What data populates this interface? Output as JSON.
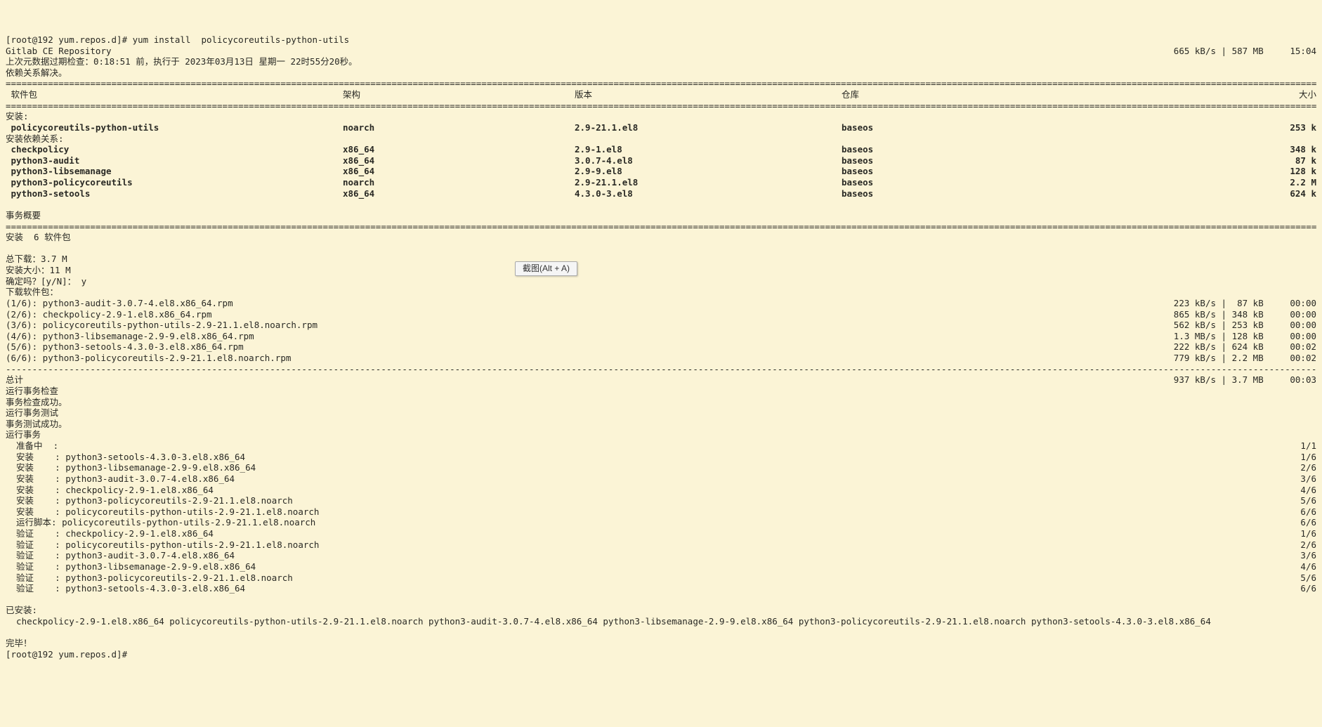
{
  "header": {
    "prompt_left": "[root@192 yum.repos.d]# yum install  policycoreutils-python-utils",
    "repo_line_left": "Gitlab CE Repository",
    "repo_line_right": "665 kB/s | 587 MB     15:04",
    "last_check": "上次元数据过期检查：0:18:51 前，执行于 2023年03月13日 星期一 22时55分20秒。",
    "dep_resolved": "依赖关系解决。"
  },
  "table_header": {
    "pkg": " 软件包",
    "arch": "架构",
    "ver": "版本",
    "repo": "仓库",
    "size": "大小"
  },
  "install_label": "安装:",
  "dep_install_label": "安装依赖关系:",
  "main_pkg": {
    "name": " policycoreutils-python-utils",
    "arch": "noarch",
    "ver": "2.9-21.1.el8",
    "repo": "baseos",
    "size": "253 k"
  },
  "deps": [
    {
      "name": " checkpolicy",
      "arch": "x86_64",
      "ver": "2.9-1.el8",
      "repo": "baseos",
      "size": "348 k"
    },
    {
      "name": " python3-audit",
      "arch": "x86_64",
      "ver": "3.0.7-4.el8",
      "repo": "baseos",
      "size": "87 k"
    },
    {
      "name": " python3-libsemanage",
      "arch": "x86_64",
      "ver": "2.9-9.el8",
      "repo": "baseos",
      "size": "128 k"
    },
    {
      "name": " python3-policycoreutils",
      "arch": "noarch",
      "ver": "2.9-21.1.el8",
      "repo": "baseos",
      "size": "2.2 M"
    },
    {
      "name": " python3-setools",
      "arch": "x86_64",
      "ver": "4.3.0-3.el8",
      "repo": "baseos",
      "size": "624 k"
    }
  ],
  "summary_label": "事务概要",
  "install_count": "安装  6 软件包",
  "totals": {
    "download": "总下载：3.7 M",
    "install_size": "安装大小：11 M",
    "confirm": "确定吗？[y/N]： y",
    "downloading": "下载软件包："
  },
  "downloads": [
    {
      "line": "(1/6): python3-audit-3.0.7-4.el8.x86_64.rpm",
      "stats": "223 kB/s |  87 kB     00:00"
    },
    {
      "line": "(2/6): checkpolicy-2.9-1.el8.x86_64.rpm",
      "stats": "865 kB/s | 348 kB     00:00"
    },
    {
      "line": "(3/6): policycoreutils-python-utils-2.9-21.1.el8.noarch.rpm",
      "stats": "562 kB/s | 253 kB     00:00"
    },
    {
      "line": "(4/6): python3-libsemanage-2.9-9.el8.x86_64.rpm",
      "stats": "1.3 MB/s | 128 kB     00:00"
    },
    {
      "line": "(5/6): python3-setools-4.3.0-3.el8.x86_64.rpm",
      "stats": "222 kB/s | 624 kB     00:02"
    },
    {
      "line": "(6/6): python3-policycoreutils-2.9-21.1.el8.noarch.rpm",
      "stats": "779 kB/s | 2.2 MB     00:02"
    }
  ],
  "total_line": {
    "left": "总计",
    "right": "937 kB/s | 3.7 MB     00:03"
  },
  "trans_lines": [
    "运行事务检查",
    "事务检查成功。",
    "运行事务测试",
    "事务测试成功。",
    "运行事务"
  ],
  "steps": [
    {
      "left": "  准备中  :",
      "right": "1/1"
    },
    {
      "left": "  安装    : python3-setools-4.3.0-3.el8.x86_64",
      "right": "1/6"
    },
    {
      "left": "  安装    : python3-libsemanage-2.9-9.el8.x86_64",
      "right": "2/6"
    },
    {
      "left": "  安装    : python3-audit-3.0.7-4.el8.x86_64",
      "right": "3/6"
    },
    {
      "left": "  安装    : checkpolicy-2.9-1.el8.x86_64",
      "right": "4/6"
    },
    {
      "left": "  安装    : python3-policycoreutils-2.9-21.1.el8.noarch",
      "right": "5/6"
    },
    {
      "left": "  安装    : policycoreutils-python-utils-2.9-21.1.el8.noarch",
      "right": "6/6"
    },
    {
      "left": "  运行脚本: policycoreutils-python-utils-2.9-21.1.el8.noarch",
      "right": "6/6"
    },
    {
      "left": "  验证    : checkpolicy-2.9-1.el8.x86_64",
      "right": "1/6"
    },
    {
      "left": "  验证    : policycoreutils-python-utils-2.9-21.1.el8.noarch",
      "right": "2/6"
    },
    {
      "left": "  验证    : python3-audit-3.0.7-4.el8.x86_64",
      "right": "3/6"
    },
    {
      "left": "  验证    : python3-libsemanage-2.9-9.el8.x86_64",
      "right": "4/6"
    },
    {
      "left": "  验证    : python3-policycoreutils-2.9-21.1.el8.noarch",
      "right": "5/6"
    },
    {
      "left": "  验证    : python3-setools-4.3.0-3.el8.x86_64",
      "right": "6/6"
    }
  ],
  "installed_label": "已安装:",
  "installed_line": "  checkpolicy-2.9-1.el8.x86_64 policycoreutils-python-utils-2.9-21.1.el8.noarch python3-audit-3.0.7-4.el8.x86_64 python3-libsemanage-2.9-9.el8.x86_64 python3-policycoreutils-2.9-21.1.el8.noarch python3-setools-4.3.0-3.el8.x86_64",
  "done": "完毕！",
  "prompt_end": "[root@192 yum.repos.d]# ",
  "tooltip": "截图(Alt + A)",
  "divider_eq": "==============================================================================================================================================================================================================================================================================",
  "divider_dash": "------------------------------------------------------------------------------------------------------------------------------------------------------------------------------------------------------------------------------------------------------------------------------"
}
